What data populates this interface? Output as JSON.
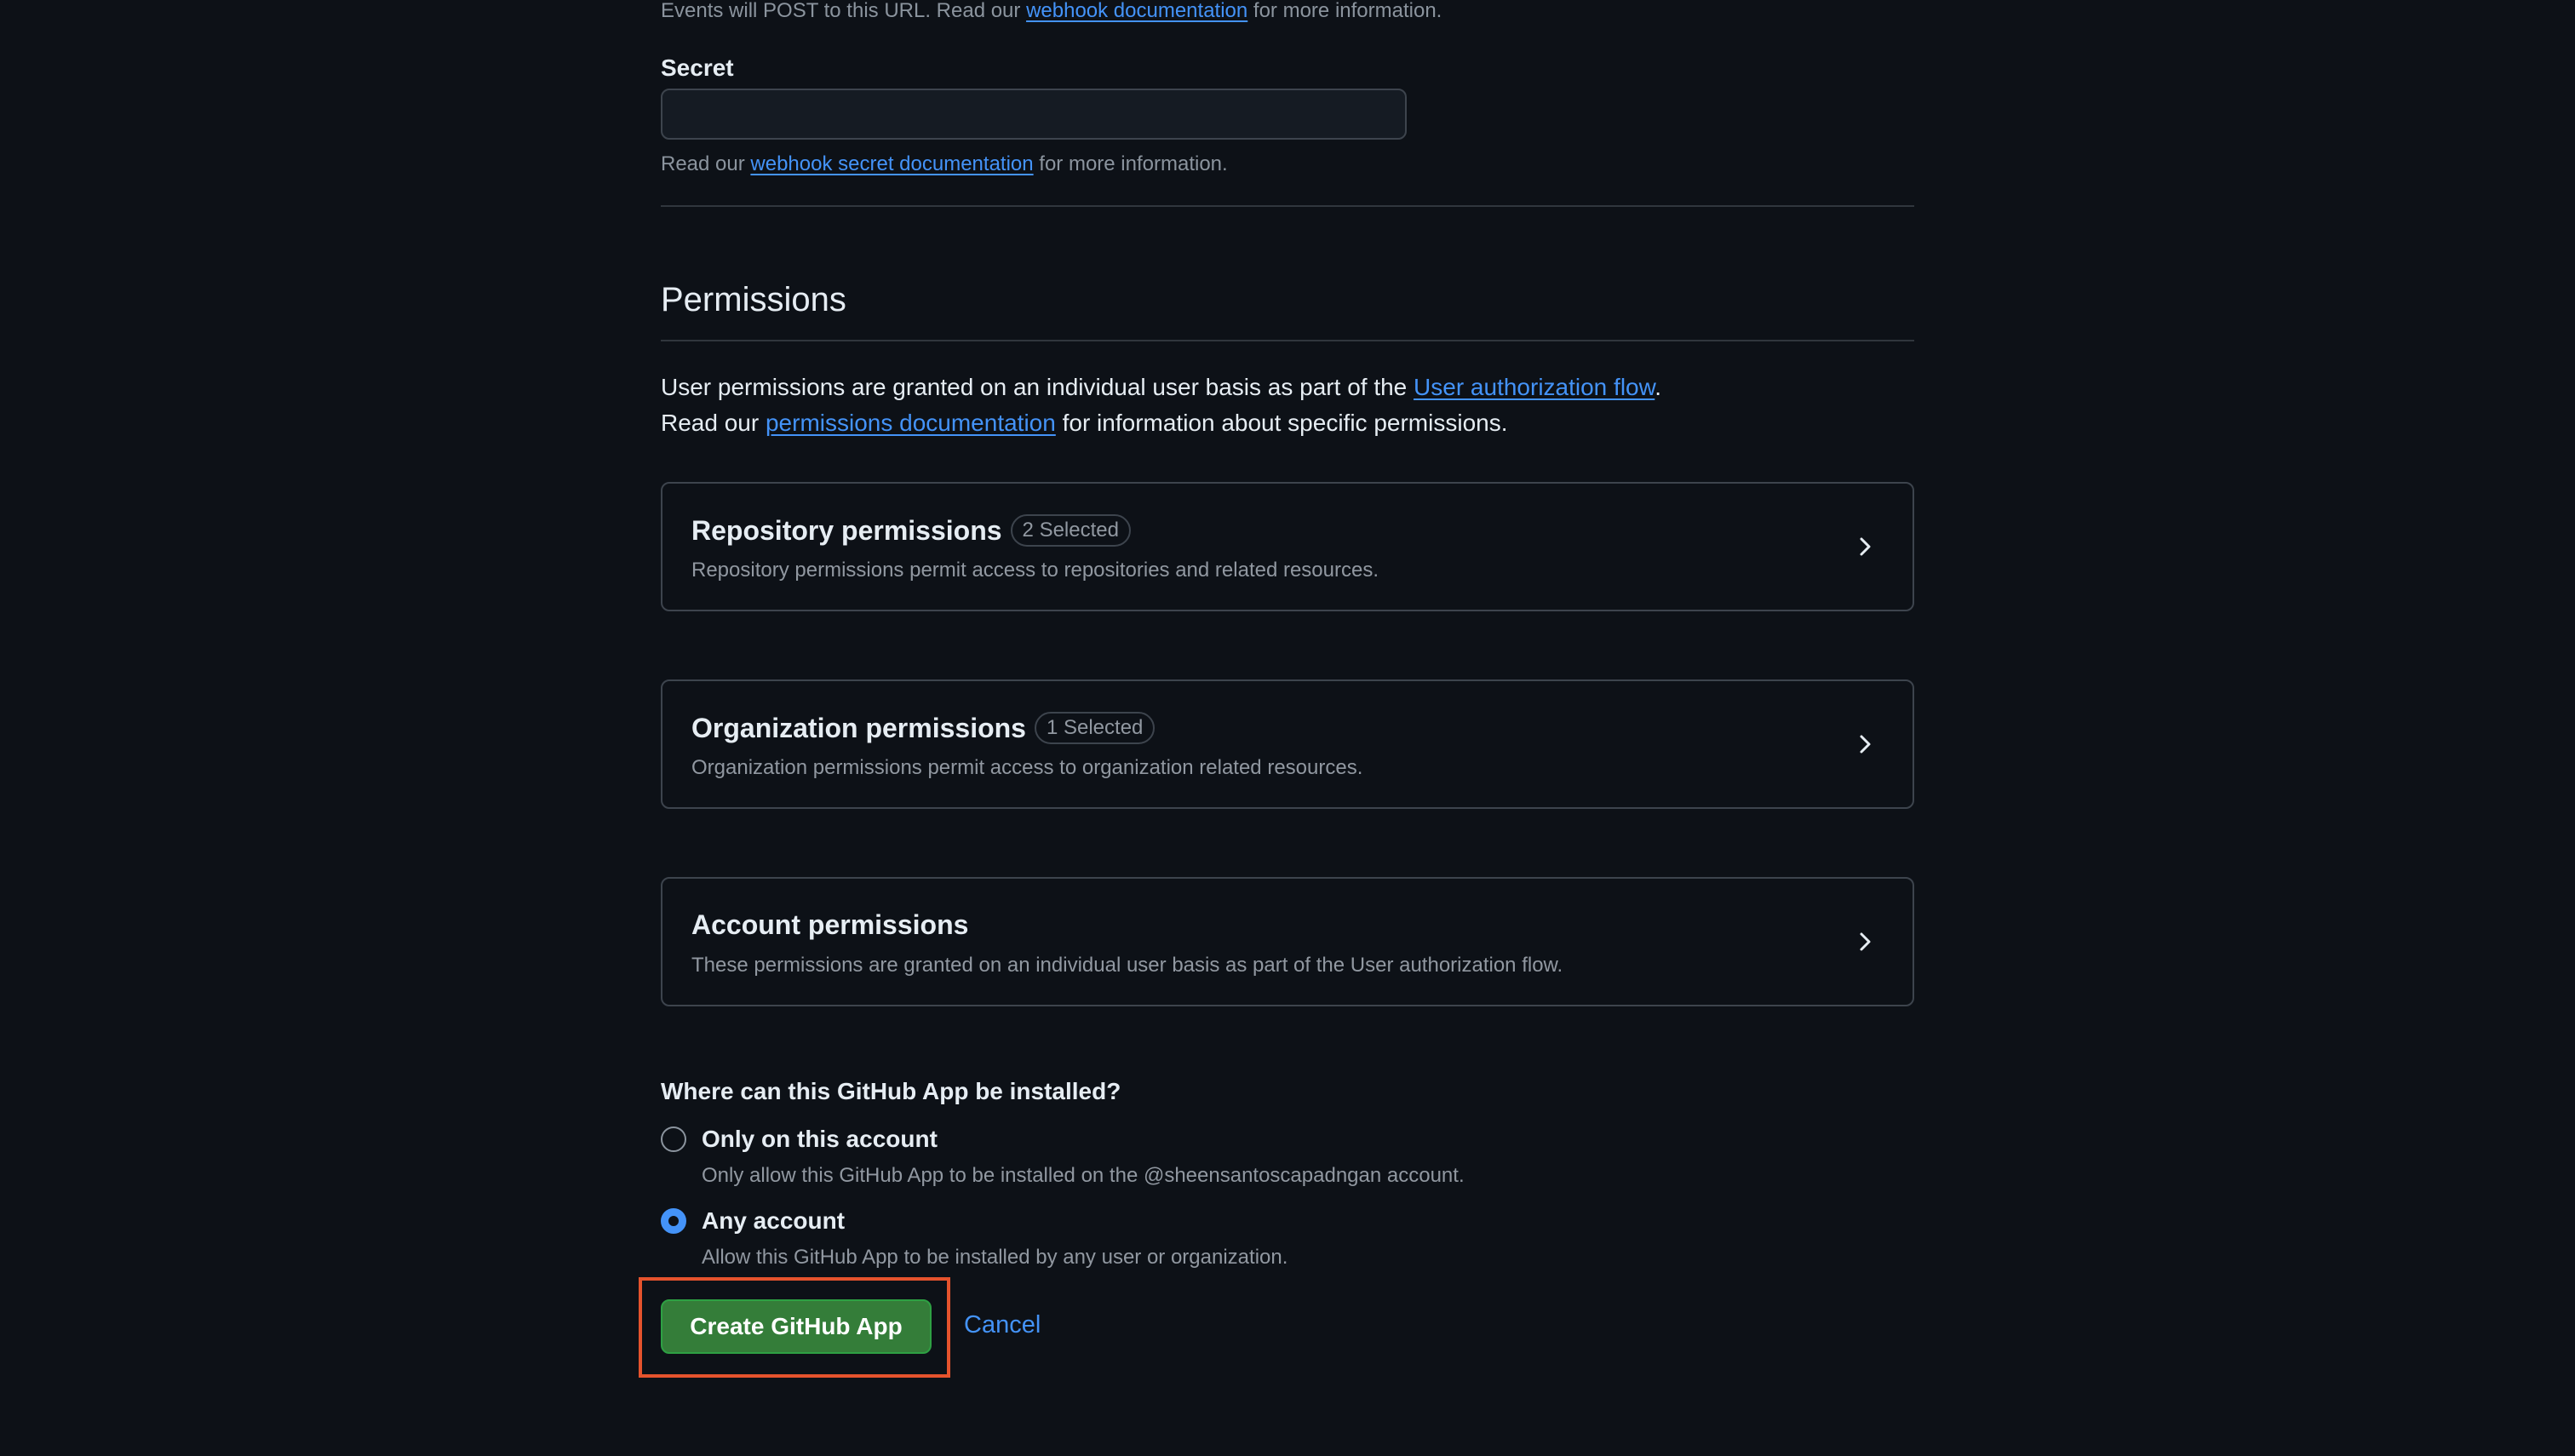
{
  "webhook": {
    "events_note_pre": "Events will POST to this URL. Read our ",
    "events_note_link": "webhook documentation",
    "events_note_post": " for more information.",
    "secret_label": "Secret",
    "secret_value": "",
    "secret_note_pre": "Read our ",
    "secret_note_link": "webhook secret documentation",
    "secret_note_post": " for more information."
  },
  "permissions": {
    "title": "Permissions",
    "intro_line1_pre": "User permissions are granted on an individual user basis as part of the ",
    "intro_line1_link": "User authorization flow",
    "intro_line1_post": ".",
    "intro_line2_pre": "Read our ",
    "intro_line2_link": "permissions documentation",
    "intro_line2_post": " for information about specific permissions.",
    "cards": [
      {
        "title": "Repository permissions",
        "badge": "2 Selected",
        "description": "Repository permissions permit access to repositories and related resources."
      },
      {
        "title": "Organization permissions",
        "badge": "1 Selected",
        "description": "Organization permissions permit access to organization related resources."
      },
      {
        "title": "Account permissions",
        "badge": "",
        "description": "These permissions are granted on an individual user basis as part of the User authorization flow."
      }
    ]
  },
  "install": {
    "question": "Where can this GitHub App be installed?",
    "options": [
      {
        "label": "Only on this account",
        "description": "Only allow this GitHub App to be installed on the @sheensantoscapadngan account.",
        "selected": false
      },
      {
        "label": "Any account",
        "description": "Allow this GitHub App to be installed by any user or organization.",
        "selected": true
      }
    ]
  },
  "actions": {
    "create_label": "Create GitHub App",
    "cancel_label": "Cancel"
  },
  "colors": {
    "background": "#0d1117",
    "link": "#4493f8",
    "primary_button": "#347d39",
    "highlight": "#e5532d"
  }
}
